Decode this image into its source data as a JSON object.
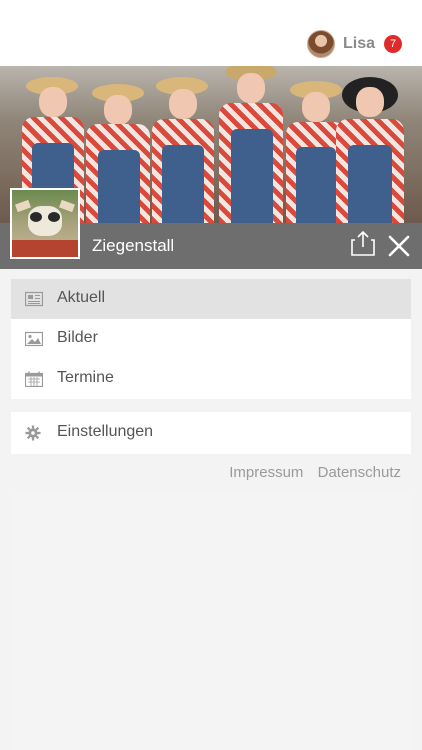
{
  "header": {
    "username": "Lisa",
    "notification_count": "7"
  },
  "group": {
    "name": "Ziegenstall"
  },
  "menu": {
    "items": [
      {
        "label": "Aktuell",
        "icon": "newspaper-icon",
        "active": true
      },
      {
        "label": "Bilder",
        "icon": "image-icon",
        "active": false
      },
      {
        "label": "Termine",
        "icon": "calendar-icon",
        "active": false
      }
    ],
    "settings_label": "Einstellungen"
  },
  "footer_links": {
    "impressum": "Impressum",
    "datenschutz": "Datenschutz"
  },
  "colors": {
    "badge": "#e02a2a",
    "bar": "#6e6e6e",
    "active_item": "#e2e2e2"
  }
}
